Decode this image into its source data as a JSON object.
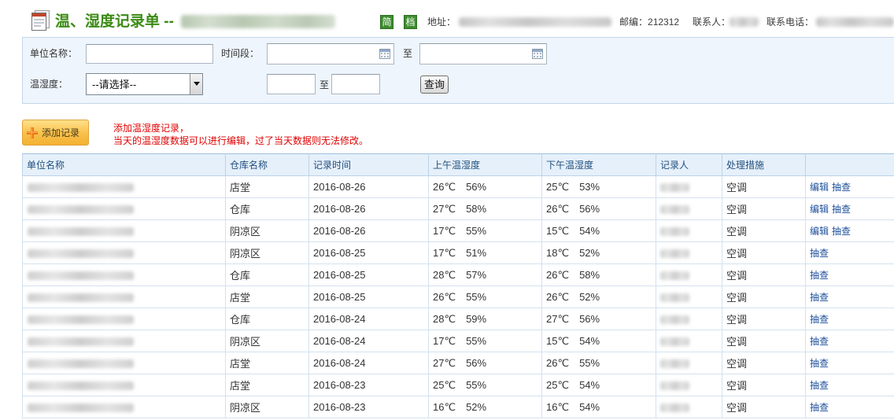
{
  "header": {
    "title": "温、湿度记录单 --",
    "badge_jian": "简",
    "badge_dang": "档",
    "address_label": "地址：",
    "postcode_label": "邮编：",
    "postcode": "212312",
    "contact_label": "联系人：",
    "phone_label": "联系电话："
  },
  "search": {
    "unit_label": "单位名称：",
    "unit_value": "",
    "period_label": "时间段：",
    "date_from": "",
    "date_sep": "至",
    "date_to": "",
    "humiture_label": "温湿度：",
    "humiture_selected": "--请选择--",
    "range_from": "",
    "range_sep": "至",
    "range_to": "",
    "query_button": "查询"
  },
  "toolbar": {
    "add_button": "添加记录",
    "notice": [
      "添加温湿度记录，",
      "当天的温湿度数据可以进行编辑，过了当天数据则无法修改。"
    ]
  },
  "table": {
    "columns": [
      "单位名称",
      "仓库名称",
      "记录时间",
      "上午温湿度",
      "下午温湿度",
      "记录人",
      "处理措施"
    ],
    "rows": [
      {
        "warehouse": "店堂",
        "date": "2016-08-26",
        "am_temp": "26℃",
        "am_humidity": "56%",
        "pm_temp": "25℃",
        "pm_humidity": "53%",
        "measure": "空调",
        "actions": [
          "编辑",
          "抽查"
        ]
      },
      {
        "warehouse": "仓库",
        "date": "2016-08-26",
        "am_temp": "27℃",
        "am_humidity": "58%",
        "pm_temp": "26℃",
        "pm_humidity": "56%",
        "measure": "空调",
        "actions": [
          "编辑",
          "抽查"
        ]
      },
      {
        "warehouse": "阴凉区",
        "date": "2016-08-26",
        "am_temp": "17℃",
        "am_humidity": "55%",
        "pm_temp": "15℃",
        "pm_humidity": "54%",
        "measure": "空调",
        "actions": [
          "编辑",
          "抽查"
        ]
      },
      {
        "warehouse": "阴凉区",
        "date": "2016-08-25",
        "am_temp": "17℃",
        "am_humidity": "51%",
        "pm_temp": "18℃",
        "pm_humidity": "52%",
        "measure": "空调",
        "actions": [
          "抽查"
        ]
      },
      {
        "warehouse": "仓库",
        "date": "2016-08-25",
        "am_temp": "28℃",
        "am_humidity": "57%",
        "pm_temp": "26℃",
        "pm_humidity": "58%",
        "measure": "空调",
        "actions": [
          "抽查"
        ]
      },
      {
        "warehouse": "店堂",
        "date": "2016-08-25",
        "am_temp": "26℃",
        "am_humidity": "55%",
        "pm_temp": "26℃",
        "pm_humidity": "52%",
        "measure": "空调",
        "actions": [
          "抽查"
        ]
      },
      {
        "warehouse": "仓库",
        "date": "2016-08-24",
        "am_temp": "28℃",
        "am_humidity": "59%",
        "pm_temp": "27℃",
        "pm_humidity": "56%",
        "measure": "空调",
        "actions": [
          "抽查"
        ]
      },
      {
        "warehouse": "阴凉区",
        "date": "2016-08-24",
        "am_temp": "17℃",
        "am_humidity": "55%",
        "pm_temp": "15℃",
        "pm_humidity": "54%",
        "measure": "空调",
        "actions": [
          "抽查"
        ]
      },
      {
        "warehouse": "店堂",
        "date": "2016-08-24",
        "am_temp": "27℃",
        "am_humidity": "56%",
        "pm_temp": "26℃",
        "pm_humidity": "55%",
        "measure": "空调",
        "actions": [
          "抽查"
        ]
      },
      {
        "warehouse": "店堂",
        "date": "2016-08-23",
        "am_temp": "25℃",
        "am_humidity": "55%",
        "pm_temp": "25℃",
        "pm_humidity": "54%",
        "measure": "空调",
        "actions": [
          "抽查"
        ]
      },
      {
        "warehouse": "阴凉区",
        "date": "2016-08-23",
        "am_temp": "16℃",
        "am_humidity": "52%",
        "pm_temp": "16℃",
        "pm_humidity": "54%",
        "measure": "空调",
        "actions": [
          "抽查"
        ]
      }
    ]
  },
  "colors": {
    "title_green": "#3b8b15",
    "badge_green": "#3d8c2e",
    "notice_red": "#e00000",
    "link_blue": "#1c4f9b",
    "panel_bg": "#eef5fc",
    "table_header_bg": "#e6f0fa",
    "add_button_orange": "#f8c04a"
  },
  "icons": {
    "header": "document-icon",
    "add": "plus-icon",
    "date_picker": "calendar-icon",
    "select": "chevron-down-icon"
  }
}
